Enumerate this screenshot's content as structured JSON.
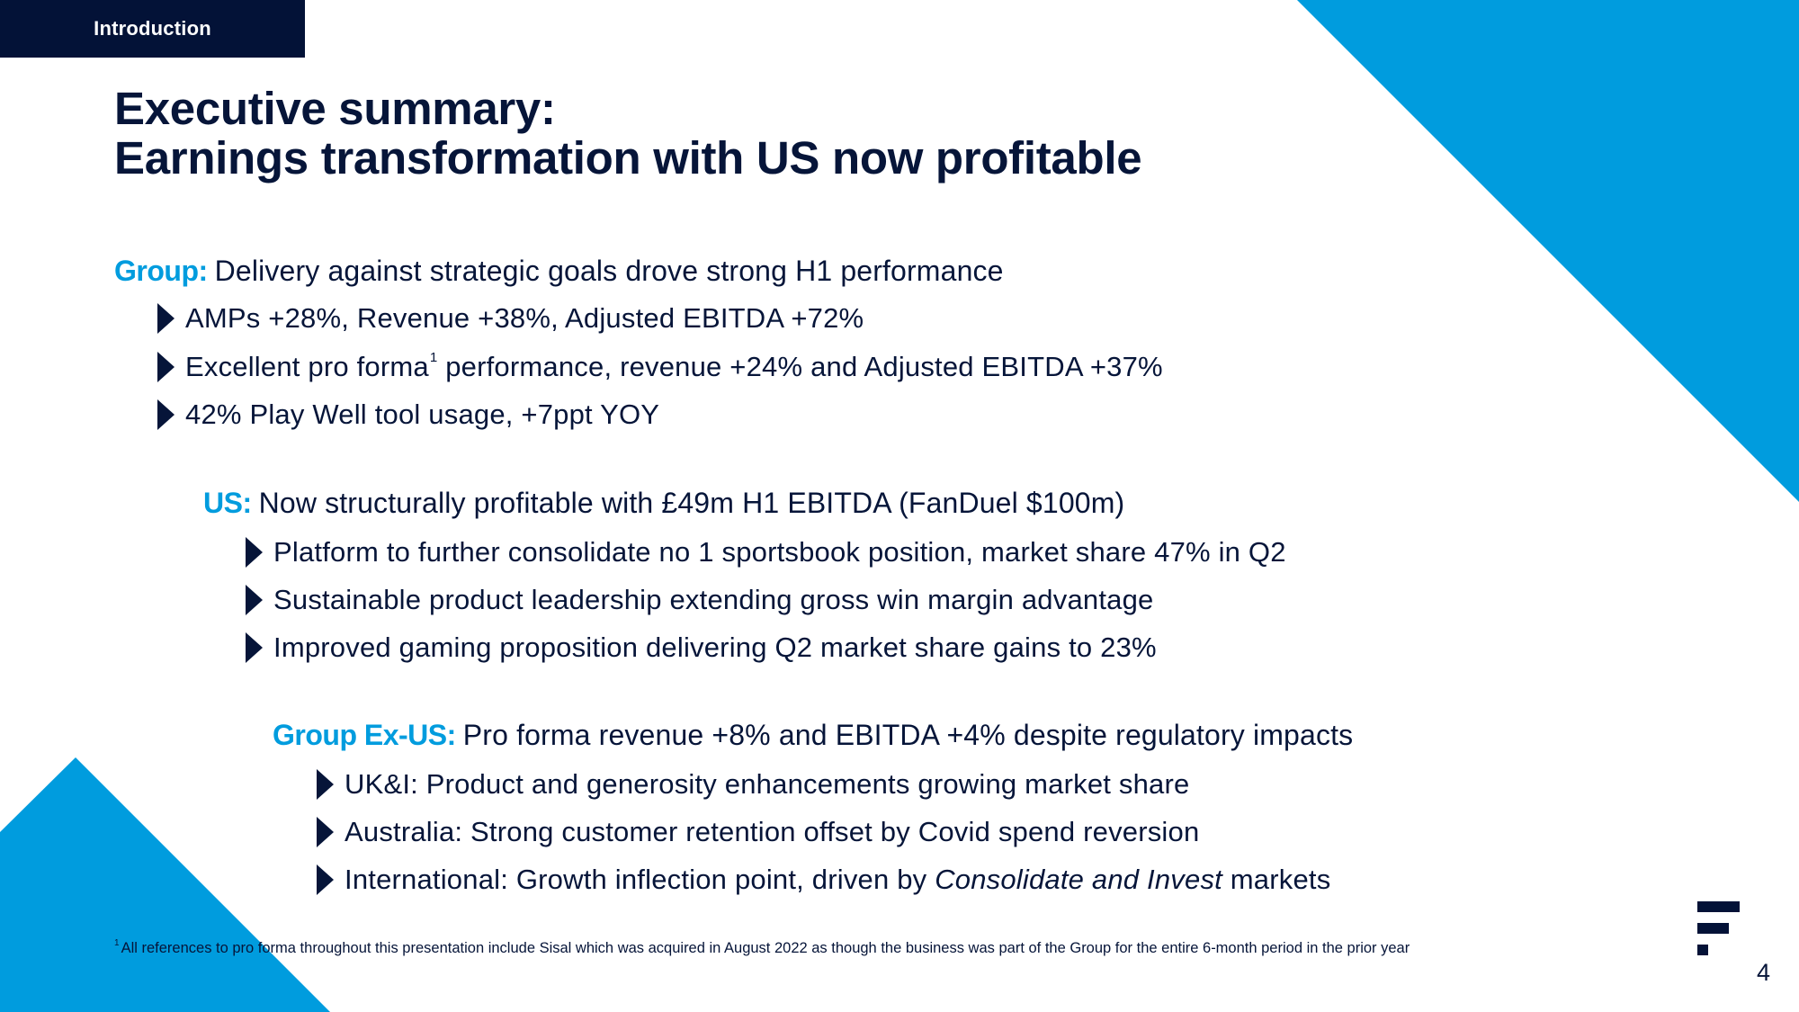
{
  "section_tab": {
    "label": "Introduction"
  },
  "title": {
    "line1": "Executive summary:",
    "line2": "Earnings transformation with US now profitable"
  },
  "colors": {
    "accent_blue": "#009cde",
    "navy": "#031237",
    "text": "#061539"
  },
  "sections": [
    {
      "label": "Group:",
      "text": "Delivery against strategic goals drove strong H1 performance",
      "bullets": [
        {
          "text": "AMPs +28%, Revenue +38%, Adjusted EBITDA +72%"
        },
        {
          "pre": "Excellent pro forma",
          "sup": "1",
          "post": " performance, revenue +24% and Adjusted EBITDA +37%"
        },
        {
          "text": "42% Play Well tool usage, +7ppt YOY"
        }
      ]
    },
    {
      "label": "US:",
      "text": "Now structurally profitable with £49m H1 EBITDA (FanDuel $100m)",
      "bullets": [
        {
          "text": "Platform to further consolidate no 1 sportsbook position, market share 47% in Q2"
        },
        {
          "text": "Sustainable product leadership extending gross win margin advantage"
        },
        {
          "text": "Improved gaming proposition delivering Q2 market share gains to 23%"
        }
      ]
    },
    {
      "label": "Group Ex-US:",
      "text": "Pro forma revenue +8% and EBITDA +4% despite regulatory impacts",
      "bullets": [
        {
          "text": "UK&I: Product and generosity enhancements growing market share"
        },
        {
          "text": "Australia: Strong customer retention offset by Covid spend reversion"
        },
        {
          "pre": "International: Growth inflection point, driven by ",
          "em": "Consolidate and Invest",
          "post": " markets"
        }
      ]
    }
  ],
  "footnote": {
    "marker": "1",
    "text": "All references to pro forma throughout this presentation include Sisal which was acquired in August 2022 as though the business was part of the Group for the entire 6-month period in the prior year"
  },
  "logo": {
    "icon": "flutter-logo-icon"
  },
  "page_number": "4"
}
